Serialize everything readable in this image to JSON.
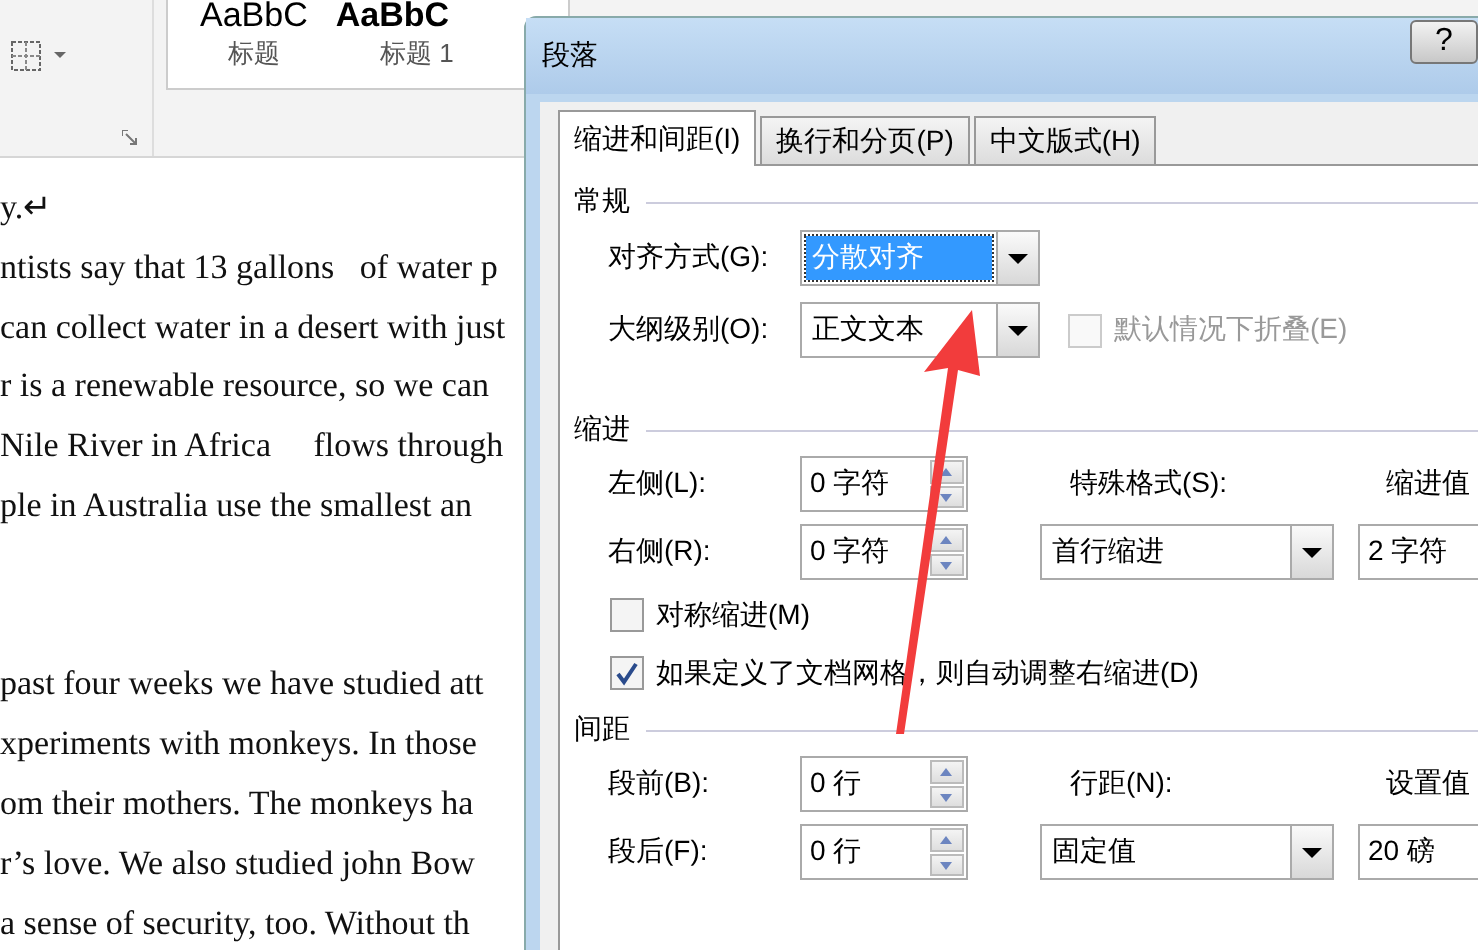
{
  "ribbon": {
    "style_previews": [
      "AaBbC",
      "AaBbC"
    ],
    "style_labels": [
      "标题",
      "标题 1"
    ]
  },
  "document": {
    "paragraphs": [
      [
        "y.↵",
        "ntists say that 13 gallons   of water p",
        "can collect water in a desert with just",
        "r is a renewable resource, so we can",
        "Nile River in Africa     flows through",
        "ple in Australia use the smallest an"
      ],
      [
        "past four weeks we have studied att",
        "xperiments with monkeys. In those",
        "om their mothers. The monkeys ha",
        "r’s love. We also studied john Bow",
        "a sense of security, too. Without th"
      ]
    ]
  },
  "dialog": {
    "title": "段落",
    "help": "?",
    "tabs": [
      {
        "label": "缩进和间距(I)",
        "selected": true
      },
      {
        "label": "换行和分页(P)",
        "selected": false
      },
      {
        "label": "中文版式(H)",
        "selected": false
      }
    ],
    "general": {
      "heading": "常规",
      "alignment": {
        "label": "对齐方式(G):",
        "value": "分散对齐",
        "selected": true
      },
      "outline_level": {
        "label": "大纲级别(O):",
        "value": "正文文本",
        "selected": false
      },
      "collapse": {
        "label": "默认情况下折叠(E)",
        "checked": false,
        "disabled": true
      }
    },
    "indent": {
      "heading": "缩进",
      "left": {
        "label": "左侧(L):",
        "value": "0 字符"
      },
      "right": {
        "label": "右侧(R):",
        "value": "0 字符"
      },
      "special": {
        "label": "特殊格式(S):",
        "value": "首行缩进"
      },
      "indent_value": {
        "label": "缩进值",
        "value": "2 字符"
      },
      "mirror": {
        "label": "对称缩进(M)",
        "checked": false,
        "disabled": false
      },
      "auto_adjust": {
        "label": "如果定义了文档网格，则自动调整右缩进(D)",
        "checked": true,
        "disabled": false
      }
    },
    "spacing": {
      "heading": "间距",
      "before": {
        "label": "段前(B):",
        "value": "0 行"
      },
      "after": {
        "label": "段后(F):",
        "value": "0 行"
      },
      "line_spacing": {
        "label": "行距(N):",
        "value": "固定值"
      },
      "set_value": {
        "label": "设置值",
        "value": "20 磅"
      }
    }
  }
}
